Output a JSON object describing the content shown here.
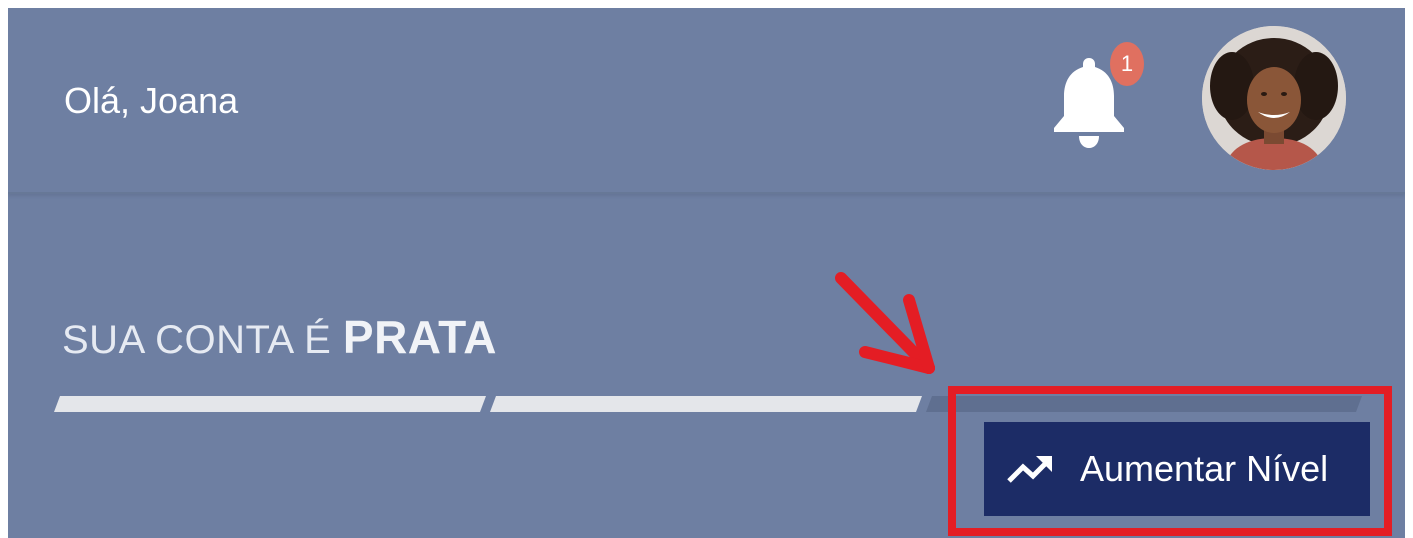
{
  "header": {
    "greeting": "Olá, Joana",
    "notifications": {
      "icon": "bell-icon",
      "badge_count": "1"
    },
    "avatar": {
      "icon": "user-avatar"
    }
  },
  "account": {
    "label_prefix": "SUA CONTA É",
    "level": "PRATA",
    "progress": {
      "segments_total": 3,
      "segments_filled": 2
    }
  },
  "action_button": {
    "icon": "trending-up-icon",
    "label": "Aumentar Nível"
  },
  "annotation": {
    "arrow_color": "#e41d24",
    "box_color": "#e41d24"
  },
  "colors": {
    "background": "#6e7fa2",
    "button": "#1c2c66",
    "badge": "#e07060",
    "progress_filled": "#e4e6ea",
    "progress_empty": "#5f6f90"
  }
}
